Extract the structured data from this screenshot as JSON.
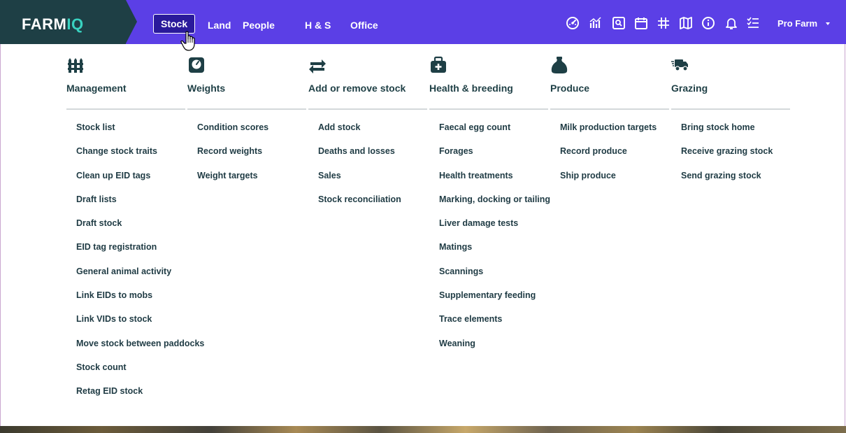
{
  "logo": {
    "main": "FARM",
    "accent": "IQ"
  },
  "nav": {
    "items": [
      {
        "label": "Stock"
      },
      {
        "label": "Land"
      },
      {
        "label": "People"
      },
      {
        "label": "H & S"
      },
      {
        "label": "Office"
      }
    ]
  },
  "toolbar_icons": [
    "dashboard-icon",
    "analytics-icon",
    "search-map-icon",
    "calendar-icon",
    "grid-tools-icon",
    "map-icon",
    "info-icon",
    "notification-bell-icon",
    "tasks-list-icon"
  ],
  "profile": {
    "label": "Pro Farm"
  },
  "colors": {
    "header_bg": "#5b3fe6",
    "logo_bg": "#1e3f45",
    "logo_accent": "#39d2c0",
    "menu_text": "#1f3b44"
  },
  "menu": {
    "management": {
      "title": "Management",
      "icon": "fence-icon",
      "items": [
        "Stock list",
        "Change stock traits",
        "Clean up EID tags",
        "Draft lists",
        "Draft stock",
        "EID tag registration",
        "General animal activity",
        "Link EIDs to mobs",
        "Link VIDs to stock",
        "Move stock between paddocks",
        "Stock count",
        "Retag EID stock"
      ]
    },
    "weights": {
      "title": "Weights",
      "icon": "scale-icon",
      "items": [
        "Condition scores",
        "Record weights",
        "Weight targets"
      ]
    },
    "add_remove": {
      "title": "Add or remove stock",
      "icon": "exchange-arrows-icon",
      "items": [
        "Add stock",
        "Deaths and losses",
        "Sales",
        "Stock reconciliation"
      ]
    },
    "health": {
      "title": "Health & breeding",
      "icon": "medical-kit-icon",
      "items": [
        "Faecal egg count",
        "Forages",
        "Health treatments",
        "Marking, docking or tailing",
        "Liver damage tests",
        "Matings",
        "Scannings",
        "Supplementary feeding",
        "Trace elements",
        "Weaning"
      ]
    },
    "produce": {
      "title": "Produce",
      "icon": "sack-icon",
      "items": [
        "Milk production targets",
        "Record produce",
        "Ship produce"
      ]
    },
    "grazing": {
      "title": "Grazing",
      "icon": "truck-icon",
      "items": [
        "Bring stock home",
        "Receive grazing stock",
        "Send grazing stock"
      ]
    }
  }
}
